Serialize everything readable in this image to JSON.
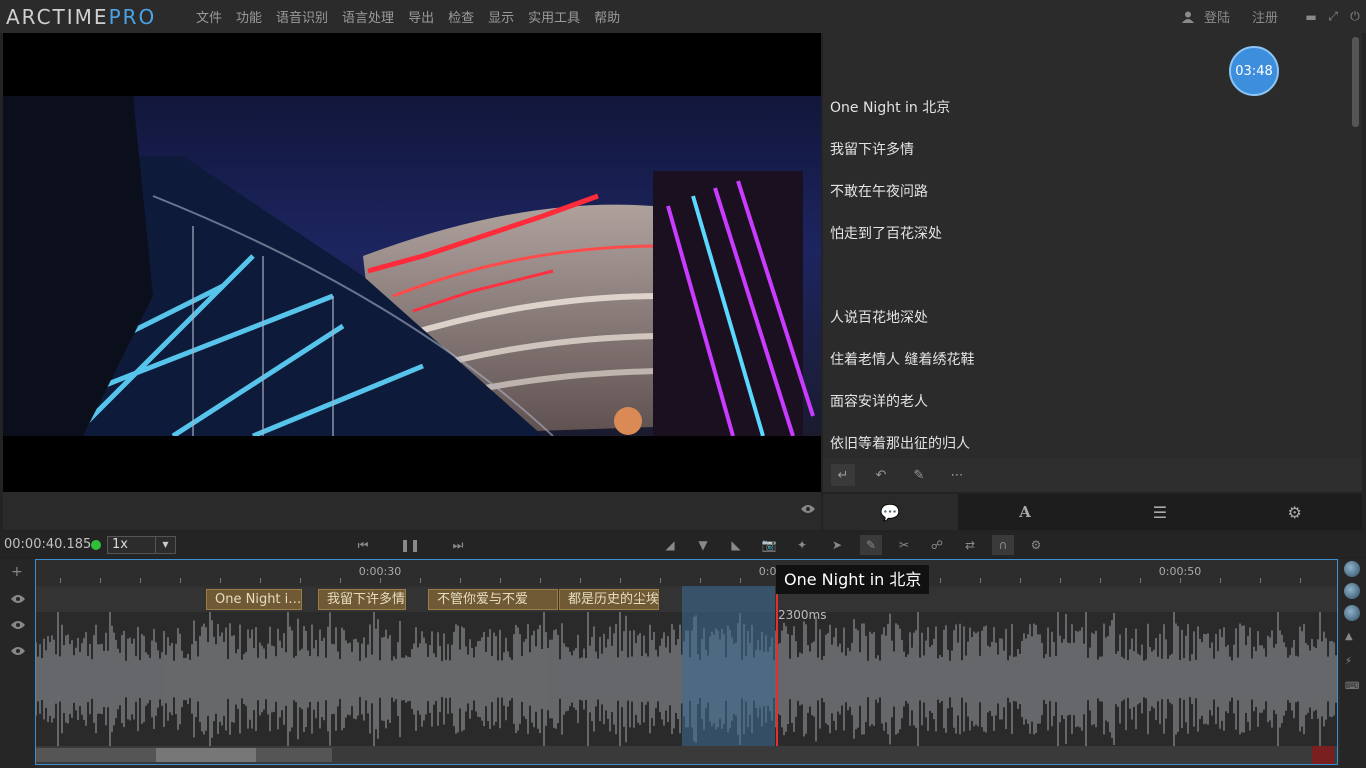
{
  "app": {
    "logo_main": "ARCTIME",
    "logo_pro": "PRO"
  },
  "menu": [
    "文件",
    "功能",
    "语音识别",
    "语言处理",
    "导出",
    "检查",
    "显示",
    "实用工具",
    "帮助"
  ],
  "account": {
    "login": "登陆",
    "register": "注册"
  },
  "timer": "03:48",
  "subtitles": [
    "One Night in 北京",
    "我留下许多情",
    "不敢在午夜问路",
    "怕走到了百花深处",
    "",
    "人说百花地深处",
    "住着老情人 缝着绣花鞋",
    "面容安详的老人",
    "依旧等着那出征的归人"
  ],
  "transport": {
    "time": "00:00:40.185",
    "speed": "1x"
  },
  "timeline": {
    "ticks": [
      "0:00:30",
      "0:00:40",
      "0:00:50"
    ],
    "segments": [
      "One Night i…",
      "我留下许多情",
      "不管你爱与不爱",
      "都是历史的尘埃"
    ],
    "ms_label": "2300ms",
    "tooltip": "One Night in 北京"
  },
  "colors": {
    "accent": "#4aa3e6",
    "segment": "#6f5a35",
    "playhead": "#e23030",
    "status": "#2fbf3a"
  }
}
